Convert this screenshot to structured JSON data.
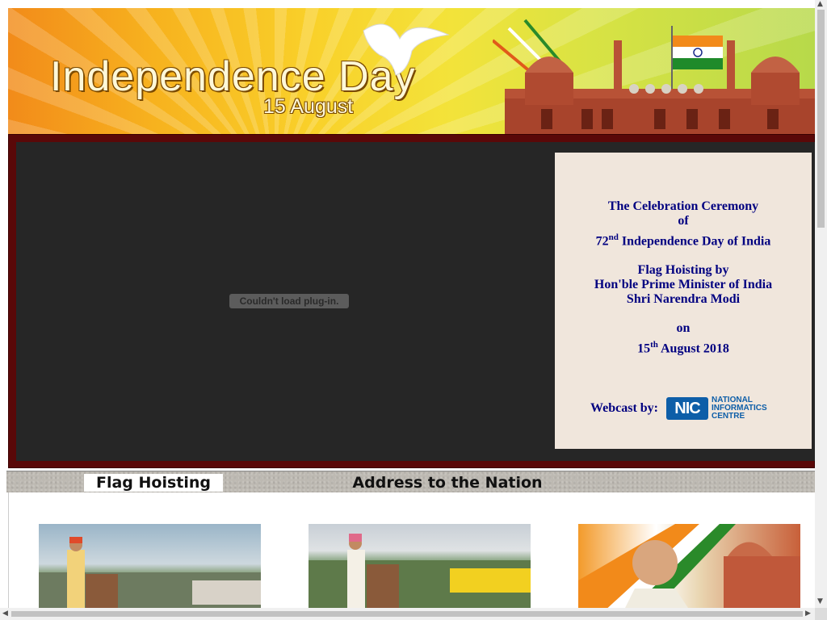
{
  "banner": {
    "title": "Independence Day",
    "date": "15 August"
  },
  "player": {
    "plugin_message": "Couldn't load plug-in."
  },
  "info": {
    "line1": "The Celebration Ceremony",
    "line2": "of",
    "ordinal_num": "72",
    "ordinal_sup": "nd",
    "line3_rest": " Independence Day of India",
    "line4": "Flag Hoisting by",
    "line5": "Hon'ble Prime Minister of India",
    "line6": "Shri Narendra Modi",
    "line7": "on",
    "day_num": "15",
    "day_sup": "th",
    "date_rest": " August 2018",
    "webcast_label": "Webcast by:",
    "nic_abbr": "NIC",
    "nic_line1": "NATIONAL",
    "nic_line2": "INFORMATICS",
    "nic_line3": "CENTRE"
  },
  "tabs": [
    {
      "label": "Flag Hoisting",
      "active": true
    },
    {
      "label": "Address to the Nation",
      "active": false
    }
  ],
  "colors": {
    "frame": "#5a0808",
    "player_bg": "#262626",
    "info_bg": "#f0e6dc",
    "info_text": "#000080",
    "nic_blue": "#0d5ea8"
  }
}
